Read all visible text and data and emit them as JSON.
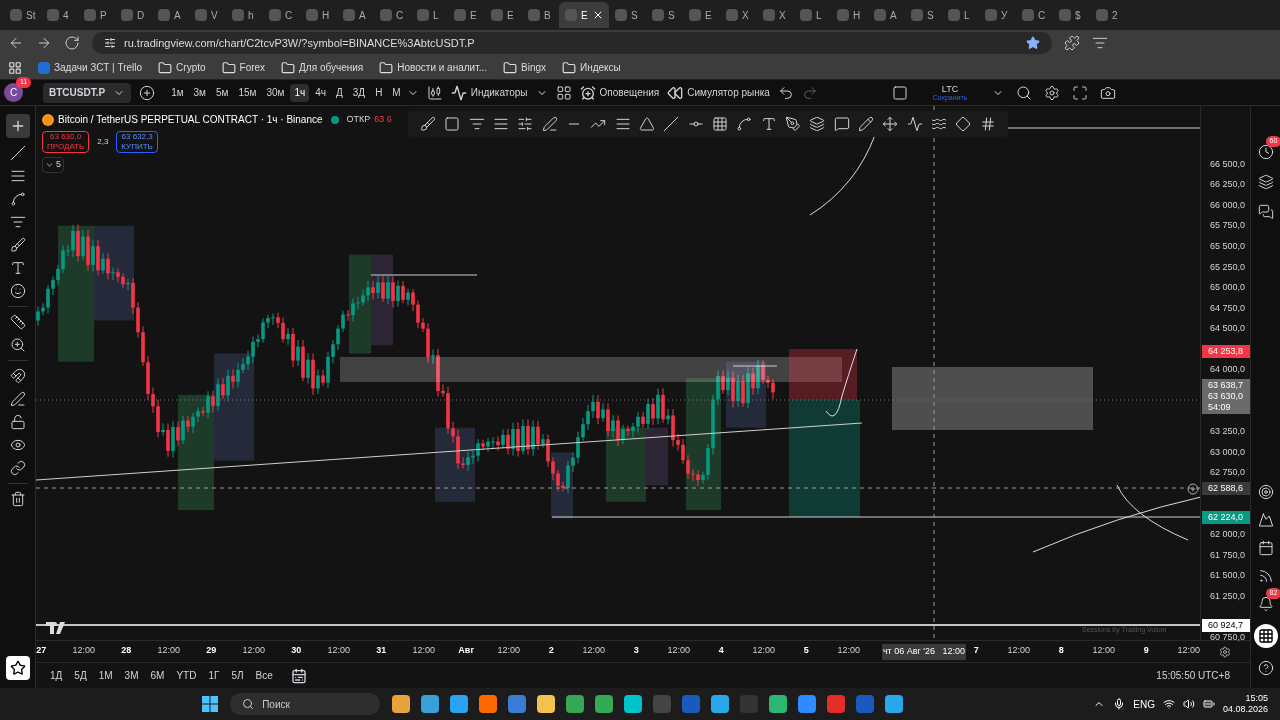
{
  "browser": {
    "tabs": [
      {
        "label": "St",
        "selected": false
      },
      {
        "label": "4",
        "selected": false
      },
      {
        "label": "P",
        "selected": false
      },
      {
        "label": "D",
        "selected": false
      },
      {
        "label": "A",
        "selected": false
      },
      {
        "label": "V",
        "selected": false
      },
      {
        "label": "h",
        "selected": false
      },
      {
        "label": "C",
        "selected": false
      },
      {
        "label": "H",
        "selected": false
      },
      {
        "label": "A",
        "selected": false
      },
      {
        "label": "C",
        "selected": false
      },
      {
        "label": "L",
        "selected": false
      },
      {
        "label": "E",
        "selected": false
      },
      {
        "label": "E",
        "selected": false
      },
      {
        "label": "B",
        "selected": false
      },
      {
        "label": "E",
        "selected": true
      },
      {
        "label": "S",
        "selected": false
      },
      {
        "label": "S",
        "selected": false
      },
      {
        "label": "E",
        "selected": false
      },
      {
        "label": "X",
        "selected": false
      },
      {
        "label": "X",
        "selected": false
      },
      {
        "label": "L",
        "selected": false
      },
      {
        "label": "H",
        "selected": false
      },
      {
        "label": "A",
        "selected": false
      },
      {
        "label": "S",
        "selected": false
      },
      {
        "label": "L",
        "selected": false
      },
      {
        "label": "У",
        "selected": false
      },
      {
        "label": "C",
        "selected": false
      },
      {
        "label": "$",
        "selected": false
      },
      {
        "label": "2",
        "selected": false
      }
    ],
    "url": "ru.tradingview.com/chart/C2tcvP3W/?symbol=BINANCE%3AbtcUSDT.P",
    "bookmarks": [
      {
        "label": "Задачи ЗСТ | Trello",
        "kind": "link"
      },
      {
        "label": "Crypto",
        "kind": "folder"
      },
      {
        "label": "Forex",
        "kind": "folder"
      },
      {
        "label": "Для обучения",
        "kind": "folder"
      },
      {
        "label": "Новости и аналит...",
        "kind": "folder"
      },
      {
        "label": "Bingx",
        "kind": "folder"
      },
      {
        "label": "Индексы",
        "kind": "folder"
      }
    ]
  },
  "toolbar": {
    "avatar": "C",
    "avatar_badge": "11",
    "symbol": "BTCUSDT.P",
    "intervals": [
      {
        "label": "1м",
        "selected": false
      },
      {
        "label": "3м",
        "selected": false
      },
      {
        "label": "5м",
        "selected": false
      },
      {
        "label": "15м",
        "selected": false
      },
      {
        "label": "30м",
        "selected": false
      },
      {
        "label": "1ч",
        "selected": true
      },
      {
        "label": "4ч",
        "selected": false
      },
      {
        "label": "Д",
        "selected": false
      },
      {
        "label": "3Д",
        "selected": false
      },
      {
        "label": "Н",
        "selected": false
      },
      {
        "label": "М",
        "selected": false
      }
    ],
    "indicators": "Индикаторы",
    "alerts": "Оповещения",
    "replay": "Симулятор рынка",
    "layout_name": "LTC",
    "layout_status": "Сохранить"
  },
  "legend": {
    "title": "Bitcoin / TetherUS PERPETUAL CONTRACT · 1ч · Binance",
    "open_label": "ОТКР",
    "open_value": "63 6",
    "sell_price": "63 630,0",
    "sell_label": "ПРОДАТЬ",
    "spread": "2,3",
    "buy_price": "63 632,3",
    "buy_label": "КУПИТЬ",
    "indicator_count": "5"
  },
  "chart": {
    "footer_note": "Sessions by Trading Volum"
  },
  "price_axis": {
    "labels": [
      "66 500,0",
      "66 250,0",
      "66 000,0",
      "65 750,0",
      "65 500,0",
      "65 250,0",
      "65 000,0",
      "64 750,0",
      "64 500,0",
      "64 000,0",
      "63 250,0",
      "63 000,0",
      "62 750,0",
      "62 000,0",
      "61 750,0",
      "61 500,0",
      "61 250,0",
      "60 750,0"
    ],
    "markers": [
      {
        "lines": [
          "64 253,8"
        ],
        "color": "#f23645",
        "kind": "plain"
      },
      {
        "lines": [
          "63 638,7",
          "63 630,0",
          "54:09"
        ],
        "color": "#6a6a6a",
        "kind": "plain"
      },
      {
        "lines": [
          "62 588,6"
        ],
        "color": "#3a3a3a",
        "kind": "crosshair"
      },
      {
        "lines": [
          "62 224,0"
        ],
        "color": "#089981",
        "kind": "plain"
      },
      {
        "lines": [
          "60 924,7"
        ],
        "color": "#ffffff",
        "kind": "plain"
      }
    ]
  },
  "time_axis": {
    "ticks": [
      {
        "label": "27",
        "kind": "day"
      },
      {
        "label": "12:00",
        "kind": "time"
      },
      {
        "label": "28",
        "kind": "day"
      },
      {
        "label": "12:00",
        "kind": "time"
      },
      {
        "label": "29",
        "kind": "day"
      },
      {
        "label": "12:00",
        "kind": "time"
      },
      {
        "label": "30",
        "kind": "day"
      },
      {
        "label": "12:00",
        "kind": "time"
      },
      {
        "label": "31",
        "kind": "day"
      },
      {
        "label": "12:00",
        "kind": "time"
      },
      {
        "label": "Авг",
        "kind": "day"
      },
      {
        "label": "12:00",
        "kind": "time"
      },
      {
        "label": "2",
        "kind": "day"
      },
      {
        "label": "12:00",
        "kind": "time"
      },
      {
        "label": "3",
        "kind": "day"
      },
      {
        "label": "12:00",
        "kind": "time"
      },
      {
        "label": "4",
        "kind": "day"
      },
      {
        "label": "12:00",
        "kind": "time"
      },
      {
        "label": "5",
        "kind": "day"
      },
      {
        "label": "12:00",
        "kind": "time"
      },
      {
        "label": "чт 06 Авг '26   12:00",
        "kind": "crosshair"
      },
      {
        "label": "7",
        "kind": "day"
      },
      {
        "label": "12:00",
        "kind": "time"
      },
      {
        "label": "8",
        "kind": "day"
      },
      {
        "label": "12:00",
        "kind": "time"
      },
      {
        "label": "9",
        "kind": "day"
      },
      {
        "label": "12:00",
        "kind": "time"
      }
    ]
  },
  "range_bar": {
    "ranges": [
      "1Д",
      "5Д",
      "1М",
      "3М",
      "6М",
      "YTD",
      "1Г",
      "5Л",
      "Все"
    ],
    "clock": "15:05:50 UTC+8"
  },
  "right_sidebar": {
    "alerts_badge": "60",
    "notifications_badge": "82"
  },
  "taskbar": {
    "search_placeholder": "Поиск",
    "language": "ENG",
    "time": "15:05",
    "date": "04.08.2026"
  }
}
